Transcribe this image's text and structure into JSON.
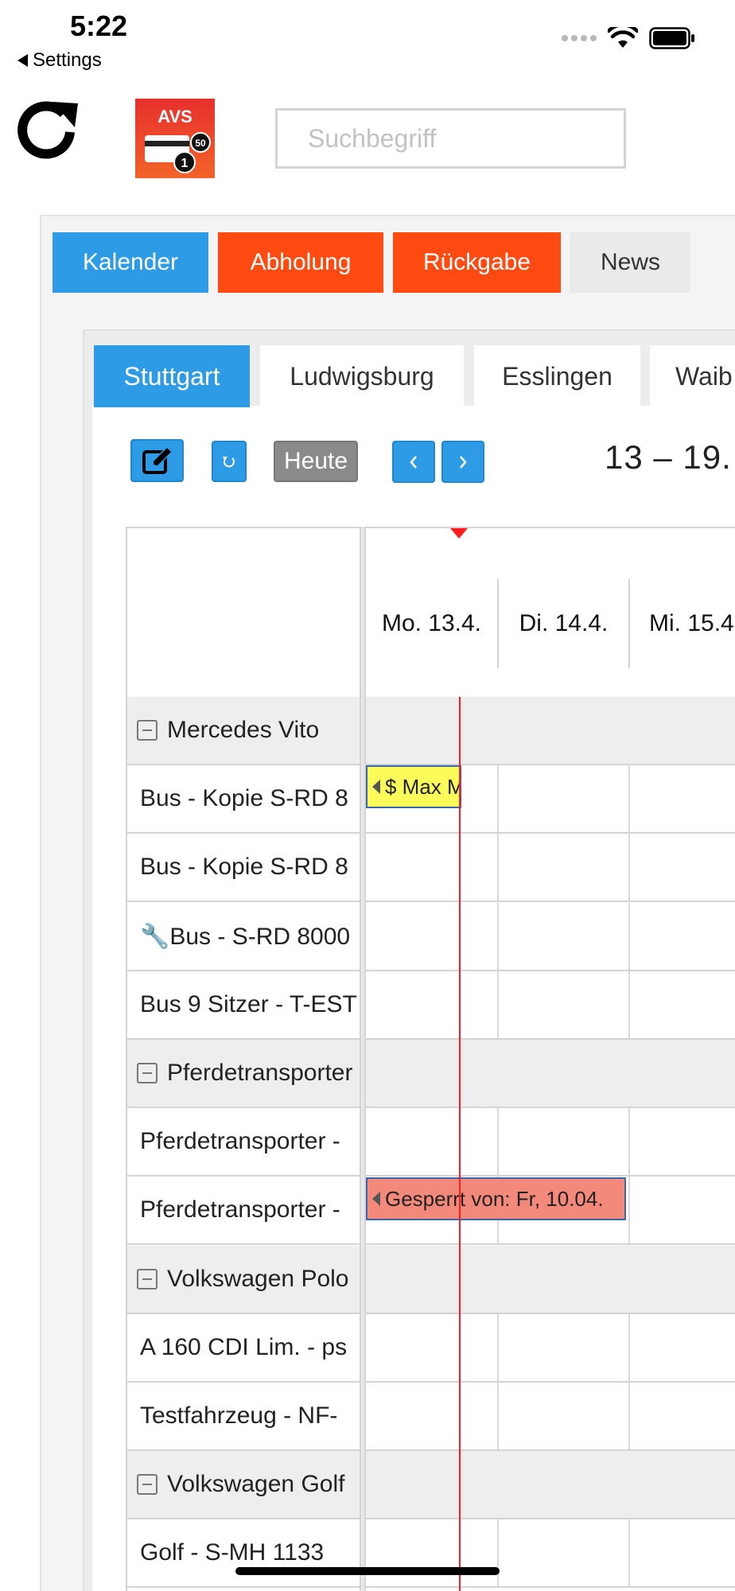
{
  "status_bar": {
    "time": "5:22",
    "back_label": "Settings"
  },
  "header": {
    "search_placeholder": "Suchbegriff"
  },
  "colors": {
    "primary_blue": "#2d9be5",
    "orange": "#ff4a12",
    "now_line": "#ff1e1e",
    "event_yellow": "#fbfb5a",
    "event_red": "#f2897a"
  },
  "main_tabs": [
    "Kalender",
    "Abholung",
    "Rückgabe",
    "News"
  ],
  "city_tabs": [
    "Stuttgart",
    "Ludwigsburg",
    "Esslingen",
    "Waib"
  ],
  "toolbar": {
    "today_label": "Heute",
    "date_range": "13 – 19."
  },
  "days": [
    "Mo. 13.4.",
    "Di. 14.4.",
    "Mi. 15.4"
  ],
  "rows": [
    {
      "type": "group",
      "label": "Mercedes Vito"
    },
    {
      "type": "item",
      "label": "Bus - Kopie S-RD 8"
    },
    {
      "type": "item",
      "label": "Bus - Kopie S-RD 8"
    },
    {
      "type": "item",
      "label": "🔧Bus - S-RD 8000"
    },
    {
      "type": "item",
      "label": "Bus 9 Sitzer - T-EST"
    },
    {
      "type": "group",
      "label": "Pferdetransporter"
    },
    {
      "type": "item",
      "label": "Pferdetransporter -"
    },
    {
      "type": "item",
      "label": "Pferdetransporter -"
    },
    {
      "type": "group",
      "label": "Volkswagen Polo"
    },
    {
      "type": "item",
      "label": "A 160 CDI Lim. - ps"
    },
    {
      "type": "item",
      "label": "Testfahrzeug - NF-"
    },
    {
      "type": "group",
      "label": "Volkswagen Golf"
    },
    {
      "type": "item",
      "label": "Golf - S-MH 1133"
    }
  ],
  "events": [
    {
      "text": "$ Max M",
      "color": "yellow"
    },
    {
      "text": "Gesperrt von: Fr, 10.04.",
      "color": "red"
    }
  ]
}
